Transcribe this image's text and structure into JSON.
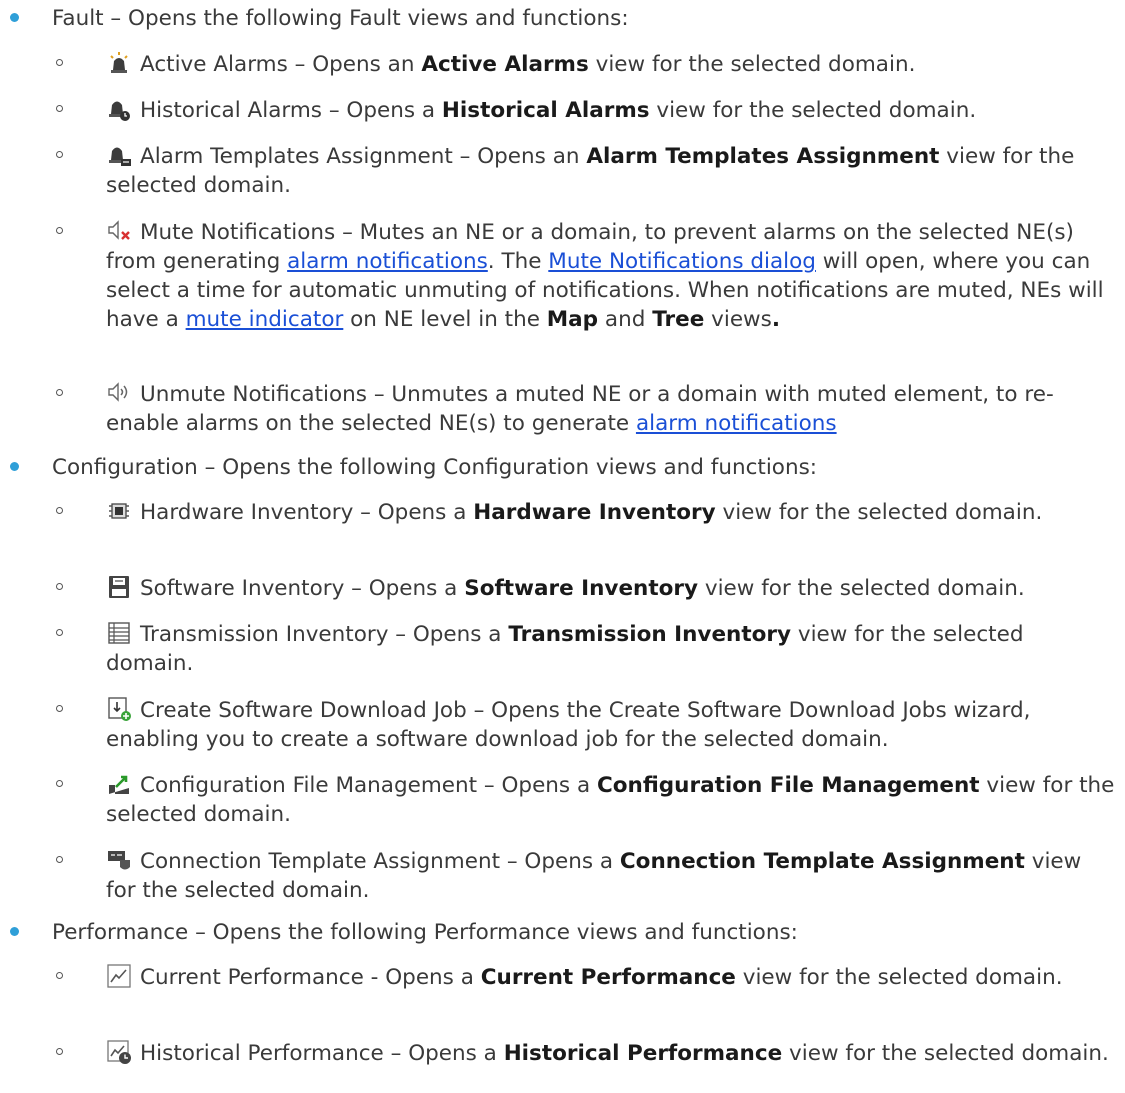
{
  "fault": {
    "text": "Fault – Opens the following Fault views and functions:",
    "items": {
      "active_alarms": {
        "lead": "Active Alarms – Opens an ",
        "bold": "Active Alarms",
        "tail": " view for the selected domain."
      },
      "historical_alarms": {
        "lead": "Historical Alarms – Opens a ",
        "bold": "Historical Alarms",
        "tail": " view for the selected domain."
      },
      "alarm_templates": {
        "lead": "Alarm Templates Assignment – Opens an ",
        "bold": "Alarm Templates Assignment",
        "tail": " view for the selected domain."
      },
      "mute": {
        "t1": "Mute Notifications – Mutes an NE or a domain, to prevent alarms on the selected NE(s) from generating ",
        "link1": "alarm notifications",
        "t2": ". The ",
        "link2": "Mute Notifications dialog",
        "t3": " will open, where you can select a time for automatic unmuting of notifications. When notifications are muted, NEs will have a ",
        "link3": "mute indicator",
        "t4": " on NE level in the ",
        "b1": "Map",
        "t5": " and ",
        "b2": "Tree",
        "t6": " views",
        "b3": "."
      },
      "unmute": {
        "t1": "Unmute Notifications – Unmutes a muted NE or a domain with muted element, to re-enable alarms on the selected NE(s) to generate ",
        "link1": "alarm notifications"
      }
    }
  },
  "configuration": {
    "text": "Configuration – Opens the following Configuration views and functions:",
    "items": {
      "hardware": {
        "lead": "Hardware Inventory – Opens a ",
        "bold": "Hardware Inventory",
        "tail": " view for the selected domain."
      },
      "software": {
        "lead": "Software Inventory – Opens a ",
        "bold": "Software Inventory",
        "tail": " view for the selected domain."
      },
      "transmission": {
        "lead": "Transmission Inventory – Opens a ",
        "bold": "Transmission Inventory",
        "tail": " view for the selected domain."
      },
      "sw_download": {
        "text": "Create Software Download Job – Opens the Create Software Download Jobs wizard, enabling you to create a software download job for the selected domain."
      },
      "config_file": {
        "lead": "Configuration File Management – Opens a ",
        "bold": "Configuration File Management",
        "tail": " view for the selected domain."
      },
      "conn_template": {
        "lead": "Connection Template Assignment – Opens a ",
        "bold": "Connection Template Assignment",
        "tail": " view for the selected domain."
      }
    }
  },
  "performance": {
    "text": "Performance – Opens the following Performance views and functions:",
    "items": {
      "current": {
        "lead": "Current Performance - Opens a ",
        "bold": "Current Performance",
        "tail": " view for the selected domain."
      },
      "historical": {
        "lead": "Historical Performance – Opens a ",
        "bold": "Historical Performance",
        "tail": " view for the selected domain."
      }
    }
  },
  "icons": {
    "active_alarms": "siren-bell-icon",
    "historical_alarms": "bell-clock-icon",
    "alarm_templates": "bell-template-icon",
    "mute": "speaker-muted-icon",
    "unmute": "speaker-sound-icon",
    "hardware": "chip-icon",
    "software": "floppy-disk-icon",
    "transmission": "table-list-icon",
    "sw_download": "download-job-icon",
    "config_file": "config-file-icon",
    "conn_template": "connection-template-icon",
    "current_perf": "chart-line-icon",
    "historical_perf": "chart-clock-icon"
  },
  "colors": {
    "bullet": "#2f9fd8",
    "link": "#1a4fd6",
    "text": "#3a3a3a"
  }
}
